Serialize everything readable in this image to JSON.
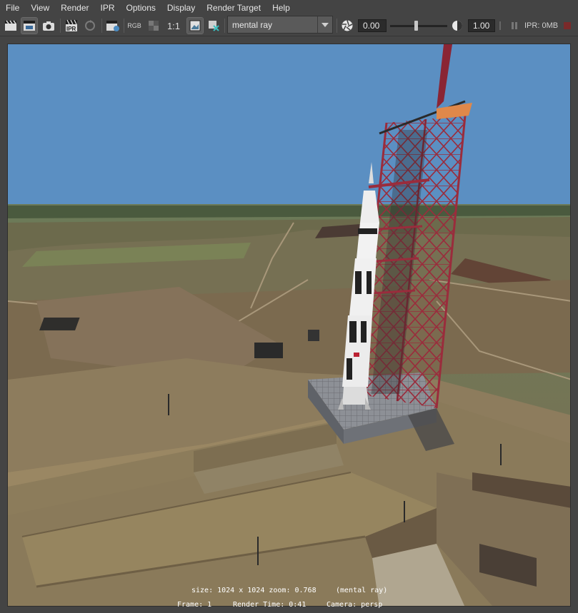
{
  "menubar": {
    "items": [
      {
        "label": "File"
      },
      {
        "label": "View"
      },
      {
        "label": "Render"
      },
      {
        "label": "IPR"
      },
      {
        "label": "Options"
      },
      {
        "label": "Display"
      },
      {
        "label": "Render Target"
      },
      {
        "label": "Help"
      }
    ]
  },
  "toolbar": {
    "ipr_label": "IPR",
    "rgb_label": "RGB",
    "ratio_label": "1:1",
    "renderer": "mental ray",
    "exposure": "0.00",
    "gamma": "1.00",
    "ipr_memory": "IPR: 0MB",
    "exposure_slider_fraction": 0.45
  },
  "status": {
    "size_zoom": "size: 1024 x 1024 zoom: 0.768",
    "renderer": "(mental ray)",
    "frame": "Frame: 1",
    "render_time": "Render Time: 0:41",
    "camera": "Camera: persp"
  },
  "icons": [
    "render-clapper-icon",
    "ipr-clapper-icon",
    "snapshot-camera-icon",
    "ipr-icon",
    "ipr-refresh-icon",
    "render-region-icon",
    "rgb-channel-icon",
    "alpha-channel-icon",
    "exposure-icon",
    "gamma-icon",
    "pause-icon",
    "stop-icon",
    "image-display-icon",
    "remove-image-icon"
  ],
  "colors": {
    "sky": "#5b8fc2",
    "tower": "#8c2a3a",
    "ground": "#8a7a5a"
  }
}
